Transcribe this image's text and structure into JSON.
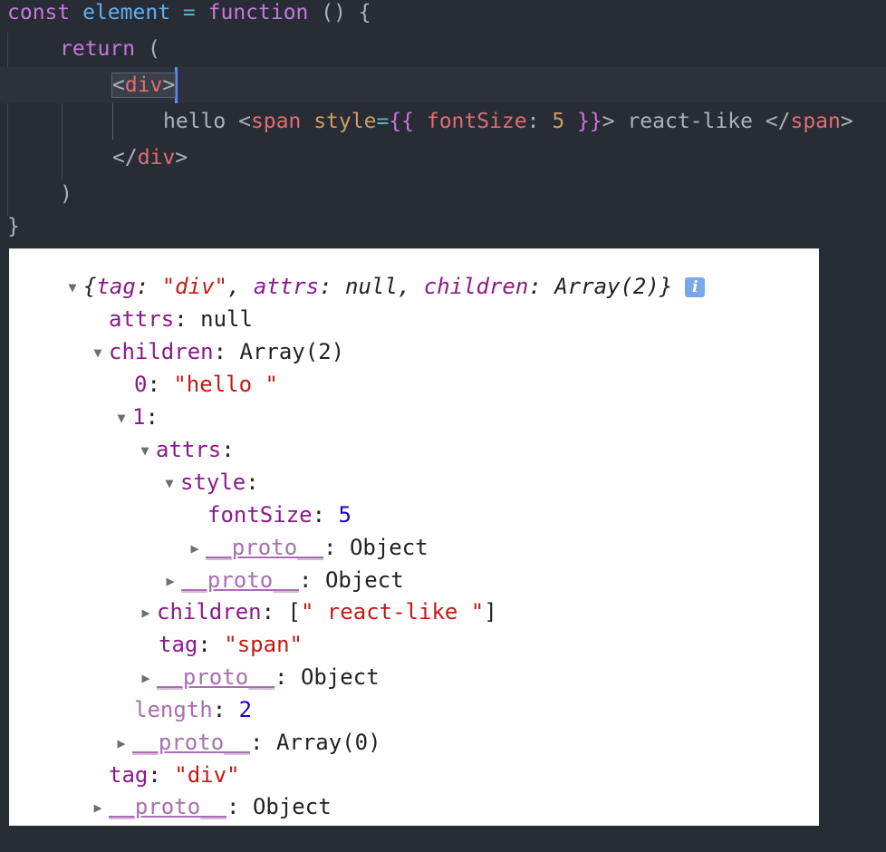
{
  "editor": {
    "line1": {
      "kw_const": "const",
      "name": "element",
      "eq": "=",
      "kw_function": "function",
      "rest": "() {"
    },
    "line2": {
      "kw_return": "return",
      "paren": "("
    },
    "line3": {
      "open": "<",
      "tag": "div",
      "close": ">"
    },
    "line4": {
      "text": "hello ",
      "lt": "<",
      "tag": "span",
      "attr": " style",
      "eq": "=",
      "brace_open": "{{",
      "prop": " fontSize",
      "colon": ": ",
      "num": "5",
      "brace_close": " }}",
      "gt": ">",
      "inner": " react-like ",
      "end_lt": "</",
      "end_tag": "span",
      "end_gt": ">"
    },
    "line5": {
      "open": "</",
      "tag": "div",
      "close": ">"
    },
    "line6": {
      "paren": ")"
    },
    "line7": {
      "brace": "}"
    }
  },
  "console": {
    "summary": {
      "open": "{",
      "k1": "tag",
      "v1": "\"div\"",
      "k2": "attrs",
      "v2": "null",
      "k3": "children",
      "v3": "Array(2)",
      "close": "}"
    },
    "attrs_key": "attrs",
    "attrs_val": "null",
    "children_key": "children",
    "children_val": "Array(2)",
    "child0_key": "0",
    "child0_val": "\"hello \"",
    "child1_key": "1",
    "c1_attrs_key": "attrs",
    "c1_style_key": "style",
    "fontsize_key": "fontSize",
    "fontsize_val": "5",
    "proto_key": "__proto__",
    "object_val": "Object",
    "c1_children_key": "children",
    "c1_children_open": "[",
    "c1_children_val": "\" react-like \"",
    "c1_children_close": "]",
    "c1_tag_key": "tag",
    "c1_tag_val": "\"span\"",
    "length_key": "length",
    "length_val": "2",
    "array0_val": "Array(0)",
    "tag_key": "tag",
    "tag_val": "\"div\"",
    "colon": ": "
  }
}
